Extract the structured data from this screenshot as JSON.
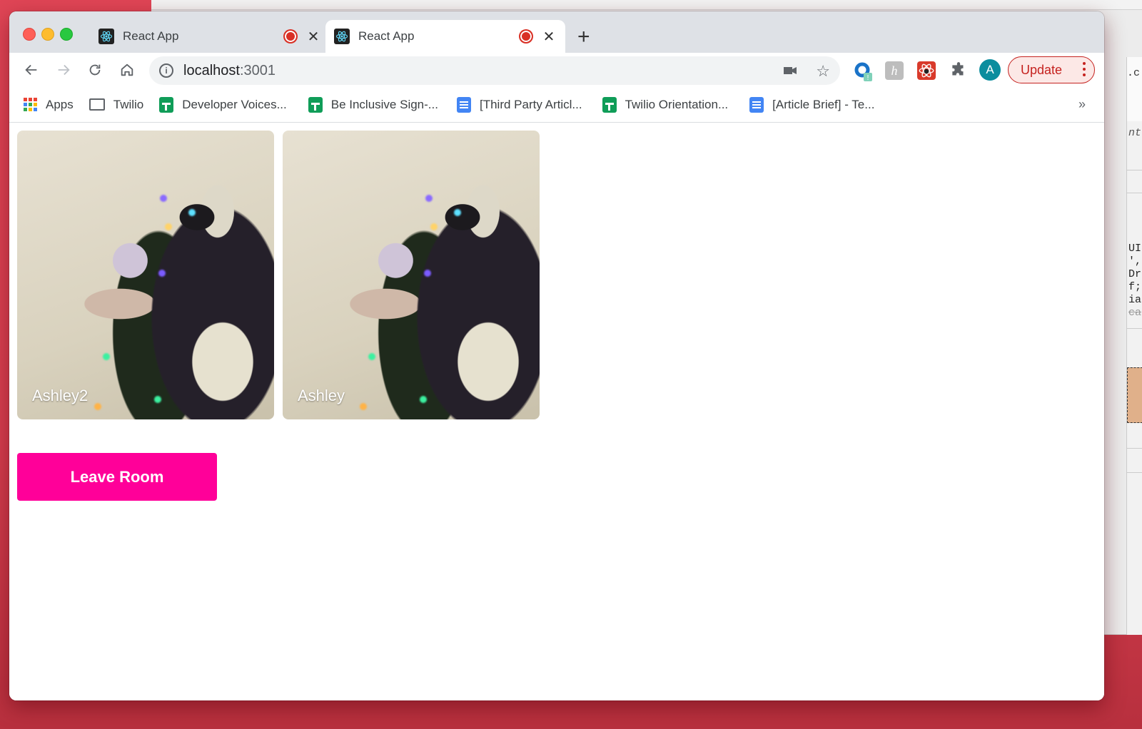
{
  "browser": {
    "tabs": [
      {
        "title": "React App",
        "active": false,
        "recording": true
      },
      {
        "title": "React App",
        "active": true,
        "recording": true
      }
    ],
    "new_tab_label": "+",
    "address": {
      "host": "localhost",
      "port": ":3001"
    },
    "update_button_label": "Update",
    "profile_initial": "A",
    "bookmarks": [
      {
        "label": "Apps",
        "icon": "apps-grid-icon"
      },
      {
        "label": "Twilio",
        "icon": "folder-icon"
      },
      {
        "label": "Developer Voices...",
        "icon": "google-sheets-icon"
      },
      {
        "label": "Be Inclusive Sign-...",
        "icon": "google-sheets-icon"
      },
      {
        "label": "[Third Party Articl...",
        "icon": "google-docs-icon"
      },
      {
        "label": "Twilio Orientation...",
        "icon": "google-sheets-icon"
      },
      {
        "label": "[Article Brief] - Te...",
        "icon": "google-docs-icon"
      }
    ],
    "bookmarks_overflow": "»",
    "extensions": [
      "loop-extension-icon",
      "h-extension-icon",
      "react-devtools-icon",
      "extensions-puzzle-icon"
    ]
  },
  "room": {
    "participants": [
      {
        "name": "Ashley2"
      },
      {
        "name": "Ashley"
      }
    ],
    "leave_button_label": "Leave Room",
    "accent_color": "#ff0099"
  },
  "background_window": {
    "snippet_top": ".c",
    "snippet_italic": "nt",
    "code_lines": [
      "UI",
      "',",
      "Dr",
      "f;",
      "ia"
    ],
    "struck_line": "ca"
  }
}
